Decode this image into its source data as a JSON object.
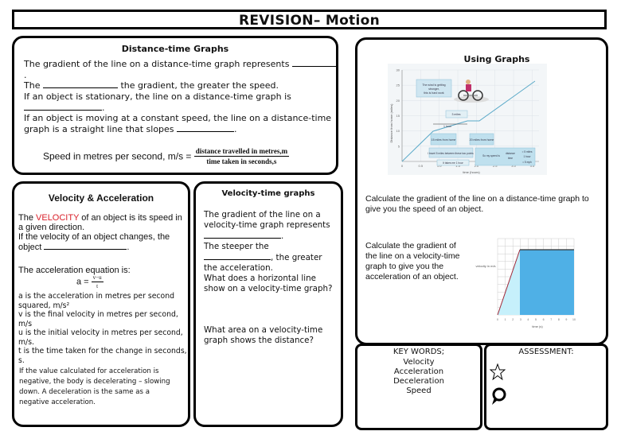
{
  "title": "REVISION– Motion",
  "distance_time": {
    "heading": "Distance-time Graphs",
    "line1_a": "The gradient of the line on a distance-time graph represents ",
    "line1_b": ".",
    "line2_a": "The ",
    "line2_b": " the gradient, the greater the speed.",
    "line3": "If an object is stationary, the line on a distance-time graph is",
    "line4_b": ".",
    "line5": "If an object is moving at a constant speed, the line on a distance-time",
    "line6_a": "graph is a straight line that slopes ",
    "line6_b": ".",
    "formula_lhs": "Speed in metres per second, m/s = ",
    "formula_num": "distance travelled in metres,m",
    "formula_den": "time taken in seconds,s"
  },
  "using_graphs": {
    "heading": "Using Graphs",
    "graph": {
      "y_label": "Distance from home (miles)",
      "x_label": "time (hours)",
      "y_ticks": [
        "5",
        "10",
        "15",
        "20",
        "25",
        "30"
      ],
      "x_ticks": [
        "0",
        "0.5",
        "1.0",
        "1.5",
        "2.0",
        "2.5",
        "3.0",
        "3.5"
      ],
      "callout_wind": "The wind is getting stronger, this is hard work",
      "callout_3miles": "3 miles",
      "callout_1hour": "1 hour",
      "callout_15": "15 miles from home",
      "callout_20": "20 miles from home",
      "callout_travel": "I travel 5 miles between these two points",
      "callout_takes": "It takes me 1 hour",
      "callout_speed_a": "So my speed is",
      "callout_speed_num": "distance",
      "callout_speed_den": "time",
      "callout_speed_r1": "= 5 miles",
      "callout_speed_r2": "1 hour",
      "callout_speed_r3": "= 5 mph"
    },
    "calc_distance": "Calculate the gradient of the line on a distance-time graph to give you the speed of an object.",
    "calc_velocity": "Calculate the gradient of the line on a velocity-time graph to give you the acceleration of an object.",
    "vt_graph": {
      "y_label": "velocity in m/s",
      "x_label": "time (s)",
      "x_ticks": [
        "0",
        "1",
        "2",
        "3",
        "4",
        "5",
        "6",
        "7",
        "8",
        "9",
        "10"
      ],
      "y_ticks": [
        "0",
        "1",
        "2",
        "3",
        "4",
        "5",
        "6",
        "7",
        "8",
        "9"
      ]
    }
  },
  "velocity_acceleration": {
    "heading": "Velocity & Acceleration",
    "p1_a": "The ",
    "p1_red": "VELOCITY",
    "p1_b": " of an object is its speed in a given direction.",
    "p2": "If the velocity of an object changes, the",
    "p3_a": "object ",
    "p3_b": ".",
    "eq_title": "The acceleration equation is:",
    "eq_lhs": "a = ",
    "eq_num": "v−u",
    "eq_den": "t",
    "def_a": "a is the acceleration in metres per second squared, m/s²",
    "def_v": "v is the final velocity in metres per second, m/s",
    "def_u": "u is the initial velocity in metres per second, m/s.",
    "def_t": "t is the time taken for the change in seconds, s.",
    "note": "If the value calculated for acceleration is negative, the body is decelerating – slowing down.  A deceleration is the same as a negative acceleration."
  },
  "velocity_time": {
    "heading": "Velocity-time graphs",
    "l1": "The gradient of the line on a",
    "l2": "velocity-time graph represents",
    "l3_b": ".",
    "l4": "The steeper the",
    "l5_b": ", the greater",
    "l6": "the acceleration.",
    "l7": "What does a horizontal line",
    "l8": "show on a velocity-time graph?",
    "q2": "What area on a velocity-time graph shows the distance?"
  },
  "key_words": {
    "heading": "KEY WORDS;",
    "items": [
      "Velocity",
      "Acceleration",
      "Deceleration",
      "Speed"
    ]
  },
  "assessment": {
    "heading": "ASSESSMENT:",
    "icons": [
      "star-icon",
      "speech-bubble-icon"
    ]
  }
}
